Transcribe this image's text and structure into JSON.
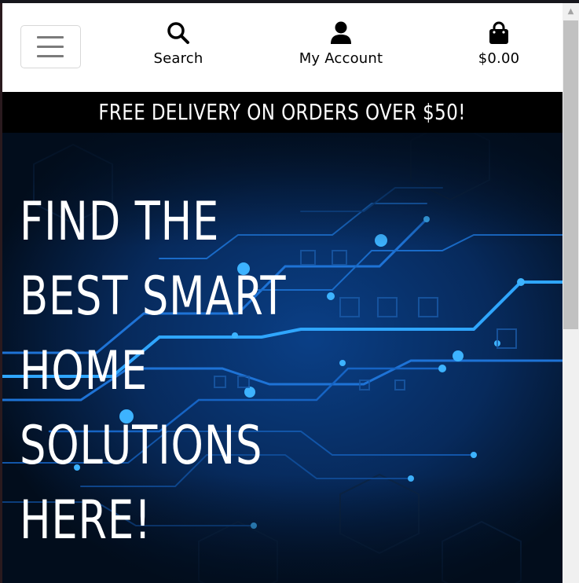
{
  "header": {
    "menu_icon": "hamburger-icon",
    "search": {
      "icon": "search-icon",
      "label": "Search"
    },
    "account": {
      "icon": "user-icon",
      "label": "My Account"
    },
    "cart": {
      "icon": "shopping-bag-icon",
      "label": "$0.00"
    }
  },
  "promo": {
    "text": "FREE DELIVERY ON ORDERS OVER $50!"
  },
  "hero": {
    "title_lines": [
      "FIND THE",
      "BEST SMART",
      "HOME",
      "SOLUTIONS",
      "HERE!"
    ],
    "background": "circuit-board-image"
  },
  "colors": {
    "hero_bg": "#020d1c",
    "circuit_glow": "#1a8cff",
    "promo_bg": "#000000"
  }
}
